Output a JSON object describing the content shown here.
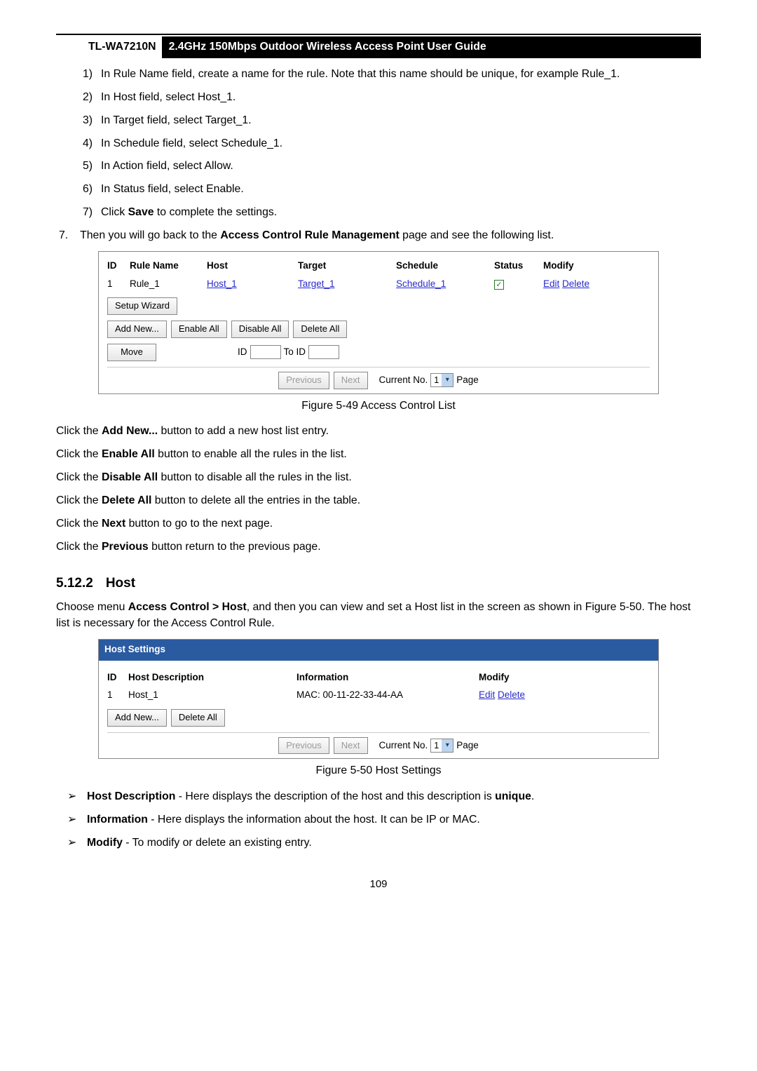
{
  "header": {
    "model": "TL-WA7210N",
    "title": "2.4GHz 150Mbps Outdoor Wireless Access Point User Guide"
  },
  "steps": {
    "s1": "In Rule Name field, create a name for the rule. Note that this name should be unique, for example Rule_1.",
    "s2": "In Host field, select Host_1.",
    "s3": "In Target field, select Target_1.",
    "s4": "In Schedule field, select Schedule_1.",
    "s5": "In Action field, select Allow.",
    "s6": "In Status field, select Enable.",
    "s7a": "Click ",
    "s7b": "Save",
    "s7c": " to complete the settings."
  },
  "step7": {
    "num": "7.",
    "a": "Then you will go back to the ",
    "b": "Access Control Rule Management",
    "c": " page and see the following list."
  },
  "fig49": {
    "head": {
      "id": "ID",
      "rule": "Rule Name",
      "host": "Host",
      "target": "Target",
      "schedule": "Schedule",
      "status": "Status",
      "modify": "Modify"
    },
    "row": {
      "id": "1",
      "rule": "Rule_1",
      "host": "Host_1",
      "target": "Target_1",
      "schedule": "Schedule_1",
      "edit": "Edit",
      "delete": "Delete"
    },
    "buttons": {
      "setup": "Setup Wizard",
      "addnew": "Add New...",
      "enableall": "Enable All",
      "disableall": "Disable All",
      "deleteall": "Delete All",
      "move": "Move",
      "id_lbl": "ID",
      "toid_lbl": "To ID",
      "prev": "Previous",
      "next": "Next",
      "curno": "Current No.",
      "curval": "1",
      "page": "Page"
    },
    "caption": "Figure 5-49 Access Control List"
  },
  "para49": {
    "p1a": "Click the ",
    "p1b": "Add New...",
    "p1c": " button to add a new host list entry.",
    "p2a": "Click the ",
    "p2b": "Enable All",
    "p2c": " button to enable all the rules in the list.",
    "p3a": "Click the ",
    "p3b": "Disable All",
    "p3c": " button to disable all the rules in the list.",
    "p4a": "Click the ",
    "p4b": "Delete All",
    "p4c": " button to delete all the entries in the table.",
    "p5a": "Click the ",
    "p5b": "Next",
    "p5c": " button to go to the next page.",
    "p6a": "Click the ",
    "p6b": "Previous",
    "p6c": " button return to the previous page."
  },
  "section": {
    "num": "5.12.2",
    "title": "Host"
  },
  "hostIntro": {
    "a": "Choose menu ",
    "b": "Access Control > Host",
    "c": ", and then you can view and set a Host list in the screen as shown in Figure 5-50. The host list is necessary for the Access Control Rule."
  },
  "fig50": {
    "title": "Host Settings",
    "head": {
      "id": "ID",
      "desc": "Host Description",
      "info": "Information",
      "modify": "Modify"
    },
    "row": {
      "id": "1",
      "desc": "Host_1",
      "info": "MAC: 00-11-22-33-44-AA",
      "edit": "Edit",
      "delete": "Delete"
    },
    "buttons": {
      "addnew": "Add New...",
      "deleteall": "Delete All",
      "prev": "Previous",
      "next": "Next",
      "curno": "Current No.",
      "curval": "1",
      "page": "Page"
    },
    "caption": "Figure 5-50 Host Settings"
  },
  "bullets": {
    "b1a": "Host Description",
    "b1b": " - Here displays the description of the host and this description is ",
    "b1c": "unique",
    "b1d": ".",
    "b2a": "Information",
    "b2b": " - Here displays the information about the host. It can be IP or MAC.",
    "b3a": "Modify",
    "b3b": " - To modify or delete an existing entry."
  },
  "pageNumber": "109"
}
